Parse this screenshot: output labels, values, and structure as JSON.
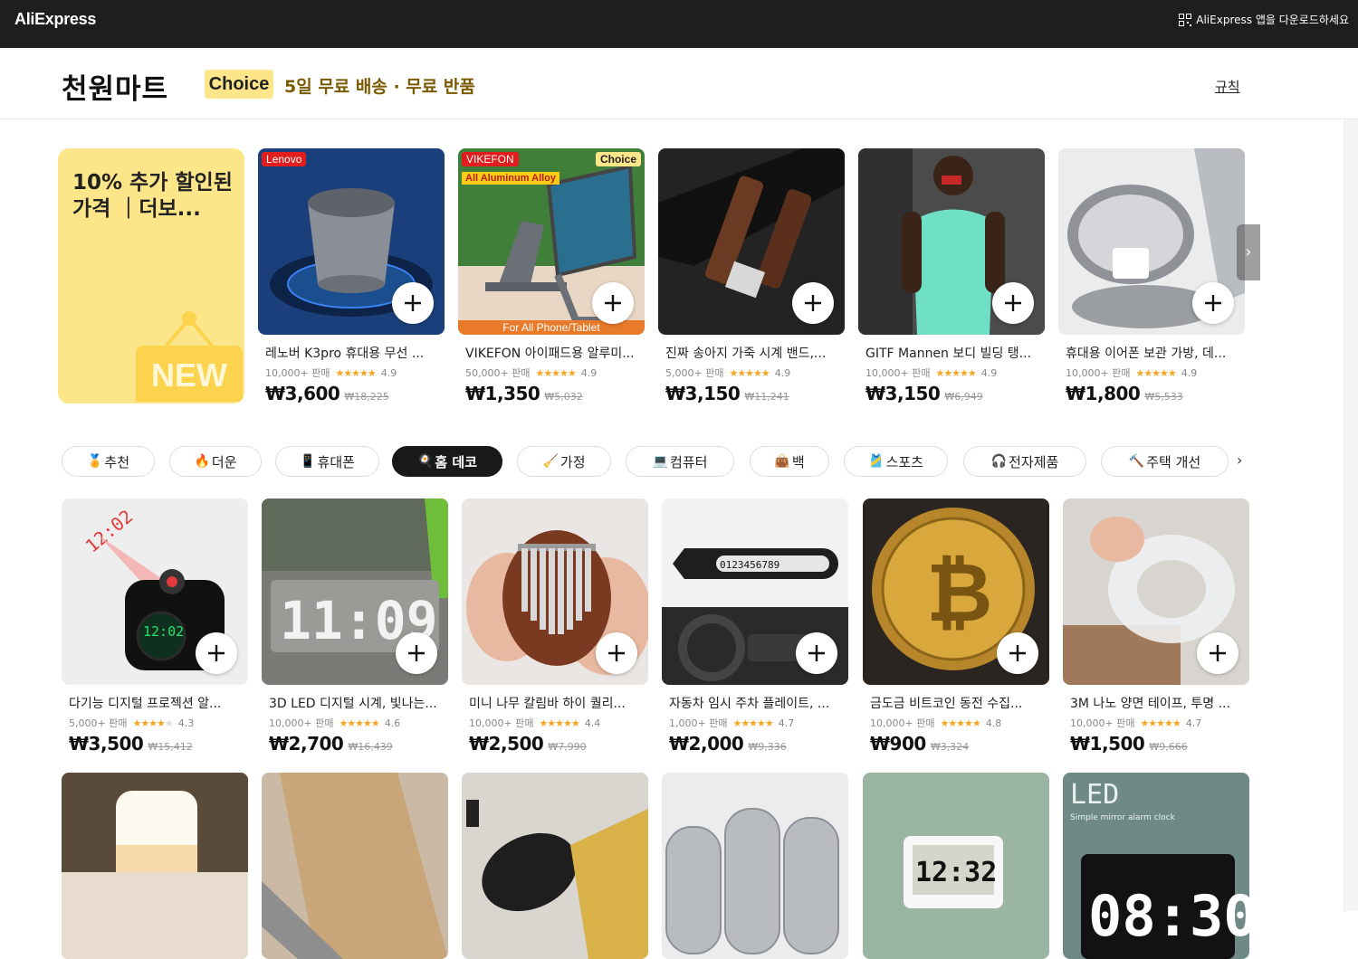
{
  "topbar": {
    "logo": "AliExpress",
    "app_download": "AliExpress 앱을 다운로드하세요",
    "app_download_icon": "qr-code-icon"
  },
  "header": {
    "title": "천원마트",
    "choice_badge": "Choice",
    "promo": "5일 무료 배송 · 무료 반품",
    "rules_link": "규칙"
  },
  "promo_card": {
    "text": "10% 추가 할인된 가격 ｜더보...",
    "new_tag": "NEW"
  },
  "featured": [
    {
      "title": "레노버 K3pro 휴대용 무선 ...",
      "sold": "10,000+ 판매",
      "rating": "4.9",
      "price": "₩3,600",
      "original": "₩18,225",
      "brand_tag": "Lenovo"
    },
    {
      "title": "VIKEFON 아이패드용 알루미...",
      "sold": "50,000+ 판매",
      "rating": "4.9",
      "price": "₩1,350",
      "original": "₩5,032",
      "brand_tag": "VIKEFON",
      "choice_tag": "Choice",
      "sub_tag": "All Aluminum Alloy",
      "foot_tag": "For All Phone/Tablet"
    },
    {
      "title": "진짜 송아지 가죽 시계 밴드,...",
      "sold": "5,000+ 판매",
      "rating": "4.9",
      "price": "₩3,150",
      "original": "₩11,241"
    },
    {
      "title": "GITF Mannen 보디 빌딩 탱...",
      "sold": "10,000+ 판매",
      "rating": "4.9",
      "price": "₩3,150",
      "original": "₩6,949"
    },
    {
      "title": "휴대용 이어폰 보관 가방, 데...",
      "sold": "10,000+ 판매",
      "rating": "4.9",
      "price": "₩1,800",
      "original": "₩5,533"
    }
  ],
  "tabs": [
    {
      "label": "추천",
      "icon": "🏅"
    },
    {
      "label": "더운",
      "icon": "🔥"
    },
    {
      "label": "휴대폰",
      "icon": "📱"
    },
    {
      "label": "홈 데코",
      "icon": "🍳"
    },
    {
      "label": "가정",
      "icon": "🧹"
    },
    {
      "label": "컴퓨터",
      "icon": "💻"
    },
    {
      "label": "백",
      "icon": "👜"
    },
    {
      "label": "스포츠",
      "icon": "🎽"
    },
    {
      "label": "전자제품",
      "icon": "🎧"
    },
    {
      "label": "주택 개선",
      "icon": "🔨"
    }
  ],
  "active_tab": "홈 데코",
  "products_row1": [
    {
      "title": "다기능 디지털 프로젝션 알...",
      "sold": "5,000+ 판매",
      "rating": "4.3",
      "price": "₩3,500",
      "original": "₩15,412"
    },
    {
      "title": "3D LED 디지털 시계, 빛나는...",
      "sold": "10,000+ 판매",
      "rating": "4.6",
      "price": "₩2,700",
      "original": "₩16,439"
    },
    {
      "title": "미니 나무 칼림바 하이 퀄리...",
      "sold": "10,000+ 판매",
      "rating": "4.4",
      "price": "₩2,500",
      "original": "₩7,990"
    },
    {
      "title": "자동차 임시 주차 플레이트, ...",
      "sold": "1,000+ 판매",
      "rating": "4.7",
      "price": "₩2,000",
      "original": "₩9,336"
    },
    {
      "title": "금도금 비트코인 동전 수집...",
      "sold": "10,000+ 판매",
      "rating": "4.8",
      "price": "₩900",
      "original": "₩3,324"
    },
    {
      "title": "3M 나노 양면 테이프, 투명 ...",
      "sold": "10,000+ 판매",
      "rating": "4.7",
      "price": "₩1,500",
      "original": "₩9,666"
    }
  ],
  "image_labels": {
    "clock_time": "12:02",
    "led_clock": "11:09",
    "plate_digits": "0123456789",
    "lcd_time": "12:32",
    "led_title": "LED",
    "led_sub": "Simple mirror alarm clock",
    "alarm_time": "08:30"
  },
  "icons": {
    "add": "plus-icon",
    "next": "chevron-right-icon"
  },
  "colors": {
    "topbar": "#1e1e1e",
    "choice": "#fde68a",
    "promo_text": "#7a5a00",
    "star": "#f5a623",
    "active_tab": "#191919"
  }
}
